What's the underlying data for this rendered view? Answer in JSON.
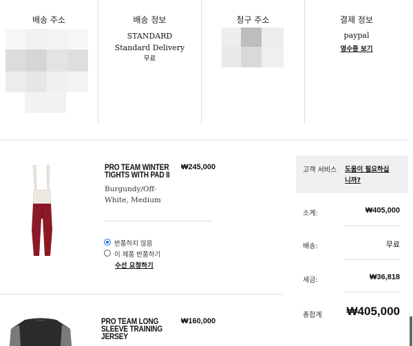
{
  "order_header": {
    "shipping_address": {
      "title": "배송 주소"
    },
    "shipping_info": {
      "title": "배송 정보",
      "method": "STANDARD",
      "description": "Standard Delivery",
      "cost": "무료"
    },
    "billing_address": {
      "title": "청구 주소"
    },
    "payment_info": {
      "title": "결제 정보",
      "method": "paypal",
      "receipt_link": "영수증 보기"
    }
  },
  "items": [
    {
      "name_line1": "PRO TEAM WINTER",
      "name_line2": "TIGHTS WITH PAD II",
      "price": "₩245,000",
      "variant_line1": "Burgundy/Off-",
      "variant_line2": "White, Medium",
      "return_options": [
        "반품하지 않음",
        "이 제품 반품하기"
      ],
      "selected_option": "반품하지 않음",
      "edit_link": "수선 요청하기"
    },
    {
      "name_line1": "PRO TEAM LONG",
      "name_line2": "SLEEVE TRAINING",
      "name_line3": "JERSEY",
      "price": "₩160,000"
    }
  ],
  "summary": {
    "customer_service": "고객 서비스",
    "help_link_line1": "도움이 필요하십",
    "help_link_line2": "니까?",
    "subtotal_label": "소계:",
    "subtotal_value": "₩405,000",
    "shipping_label": "배송:",
    "shipping_value": "무료",
    "tax_label": "세금:",
    "tax_value": "₩36,818",
    "total_label": "총합계",
    "total_value": "₩405,000"
  },
  "colors": {
    "radio_accent": "#1a6fe0",
    "summary_header_bg": "#f0f0f0",
    "tights": "#8b1a26"
  }
}
